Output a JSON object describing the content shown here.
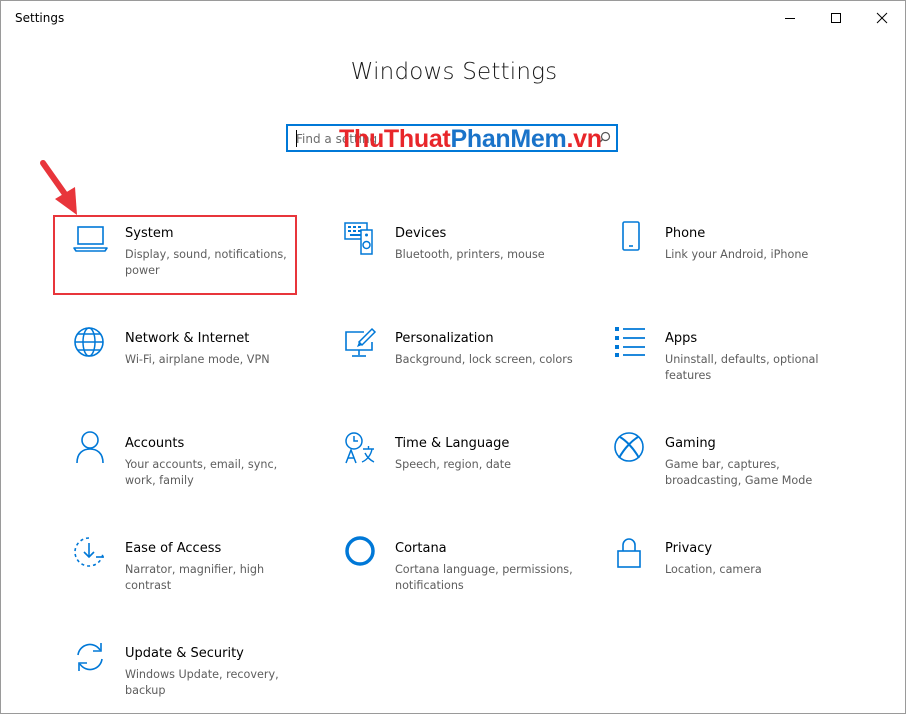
{
  "window": {
    "title": "Settings"
  },
  "header": {
    "title": "Windows Settings"
  },
  "search": {
    "placeholder": "Find a setting"
  },
  "watermark": {
    "part1": "ThuThuat",
    "part2": "PhanMem",
    "part3": ".vn"
  },
  "tiles": [
    {
      "name": "System",
      "desc": "Display, sound, notifications, power",
      "icon": "laptop-icon"
    },
    {
      "name": "Devices",
      "desc": "Bluetooth, printers, mouse",
      "icon": "keyboard-speaker-icon"
    },
    {
      "name": "Phone",
      "desc": "Link your Android, iPhone",
      "icon": "phone-icon"
    },
    {
      "name": "Network & Internet",
      "desc": "Wi-Fi, airplane mode, VPN",
      "icon": "globe-icon"
    },
    {
      "name": "Personalization",
      "desc": "Background, lock screen, colors",
      "icon": "paint-screen-icon"
    },
    {
      "name": "Apps",
      "desc": "Uninstall, defaults, optional features",
      "icon": "apps-list-icon"
    },
    {
      "name": "Accounts",
      "desc": "Your accounts, email, sync, work, family",
      "icon": "person-icon"
    },
    {
      "name": "Time & Language",
      "desc": "Speech, region, date",
      "icon": "time-language-icon"
    },
    {
      "name": "Gaming",
      "desc": "Game bar, captures, broadcasting, Game Mode",
      "icon": "xbox-icon"
    },
    {
      "name": "Ease of Access",
      "desc": "Narrator, magnifier, high contrast",
      "icon": "ease-of-access-icon"
    },
    {
      "name": "Cortana",
      "desc": "Cortana language, permissions, notifications",
      "icon": "cortana-icon"
    },
    {
      "name": "Privacy",
      "desc": "Location, camera",
      "icon": "lock-icon"
    },
    {
      "name": "Update & Security",
      "desc": "Windows Update, recovery, backup",
      "icon": "sync-icon"
    }
  ],
  "colors": {
    "accent": "#0078d7",
    "highlight": "#e8353b",
    "watermark_red": "#e8262a",
    "watermark_blue": "#1a73c9"
  }
}
